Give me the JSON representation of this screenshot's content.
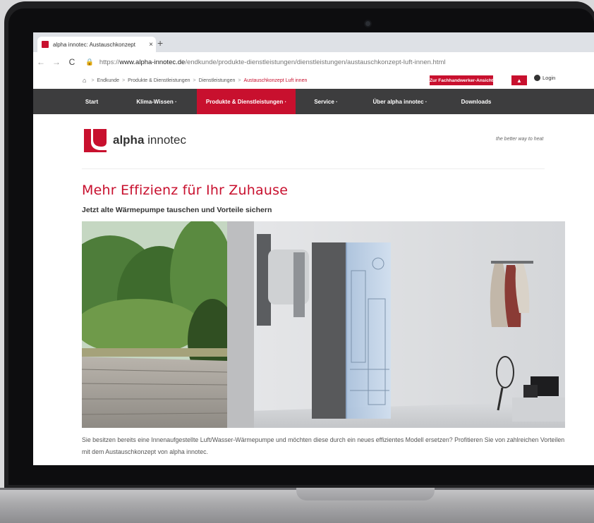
{
  "browser": {
    "tab_title": "alpha innotec: Austauschkonzept",
    "tab_close": "×",
    "new_tab": "+",
    "back": "←",
    "forward": "→",
    "reload": "C",
    "lock": "🔒",
    "url_prefix": "https://",
    "url_host": "www.alpha-innotec.de",
    "url_path": "/endkunde/produkte-dienstleistungen/dienstleistungen/austauschkonzept-luft-innen.html"
  },
  "utility": {
    "breadcrumb": [
      "Endkunde",
      "Produkte & Dienstleistungen",
      "Dienstleistungen",
      "Austauschkonzept Luft innen"
    ],
    "breadcrumb_sep": ">",
    "fachpartner_button": "Zur Fachhandwerker-Ansicht",
    "login": "Login"
  },
  "nav": {
    "items": [
      {
        "label": "Start"
      },
      {
        "label": "Klima-Wissen ·"
      },
      {
        "label": "Produkte & Dienstleistungen ·"
      },
      {
        "label": "Service ·"
      },
      {
        "label": "Über alpha innotec ·"
      },
      {
        "label": "Downloads"
      }
    ],
    "active_index": 2
  },
  "brand": {
    "name_bold": "alpha",
    "name_light": "innotec",
    "tagline": "the better way to heat",
    "accent": "#c8102e"
  },
  "content": {
    "headline": "Mehr Effizienz für Ihr Zuhause",
    "subheadline": "Jetzt alte Wärmepumpe tauschen und Vorteile sichern",
    "paragraph": "Sie besitzen bereits eine Innenaufgestellte Luft/Wasser-Wärmepumpe und möchten diese durch ein neues effizientes Modell ersetzen? Profitieren Sie von zahlreichen Vorteilen mit dem Austauschkonzept von alpha innotec."
  }
}
